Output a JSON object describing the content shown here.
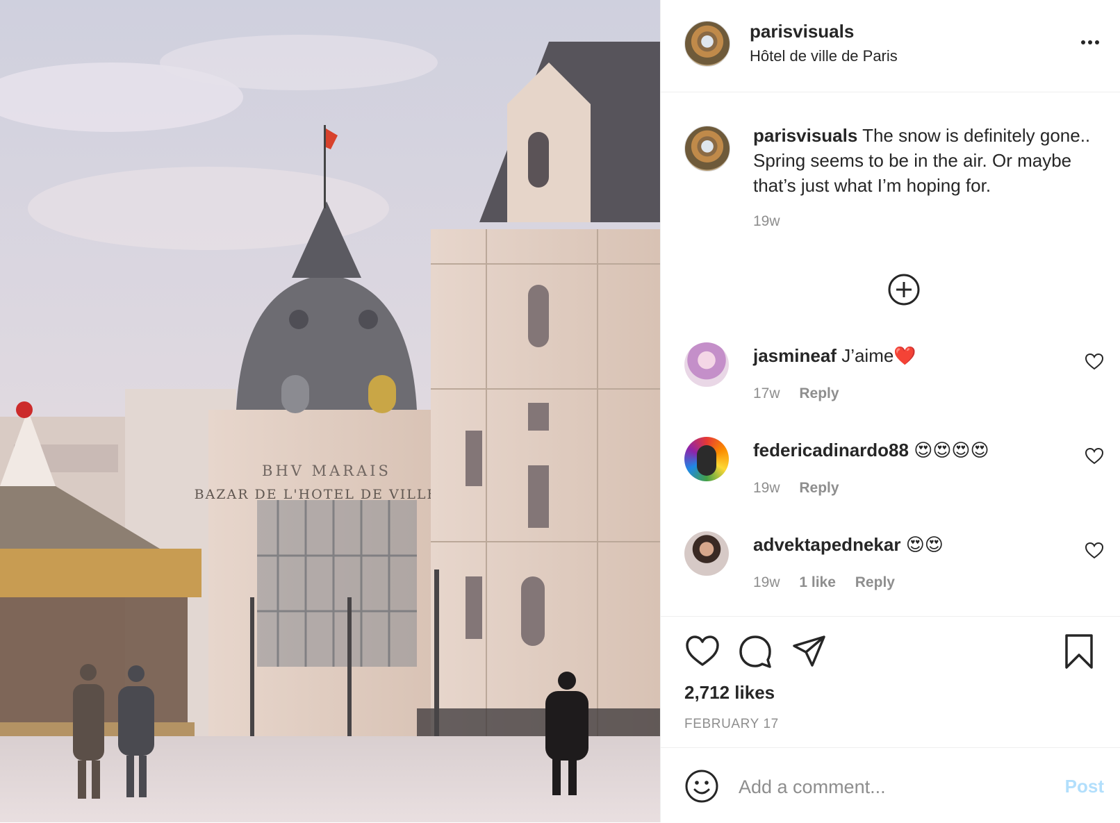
{
  "post": {
    "username": "parisvisuals",
    "location": "Hôtel de ville de Paris",
    "more_icon": "more-horizontal-icon",
    "photo_signage": {
      "bhv_sign": "BHV MARAIS",
      "bazaar_sign": "BAZAR DE L'HOTEL DE VILLE"
    }
  },
  "caption": {
    "username": "parisvisuals",
    "text": "The snow is definitely gone.. Spring seems to be in the air. Or maybe that’s just what I’m hoping for.",
    "time": "19w"
  },
  "load_more_icon": "plus-circle-icon",
  "comments": [
    {
      "username": "jasmineaf",
      "text": "J’aime❤️",
      "time": "17w",
      "likes": "",
      "reply_label": "Reply"
    },
    {
      "username": "federicadinardo88",
      "text": "😍😍😍😍",
      "time": "19w",
      "likes": "",
      "reply_label": "Reply"
    },
    {
      "username": "advektapednekar",
      "text": "😍😍",
      "time": "19w",
      "likes": "1 like",
      "reply_label": "Reply"
    }
  ],
  "actions": {
    "icons": [
      "heart-icon",
      "comment-icon",
      "share-icon",
      "bookmark-icon"
    ],
    "likes": "2,712 likes",
    "date": "FEBRUARY 17"
  },
  "add_comment": {
    "placeholder": "Add a comment...",
    "post_label": "Post",
    "post_color": "#b2dffc"
  }
}
